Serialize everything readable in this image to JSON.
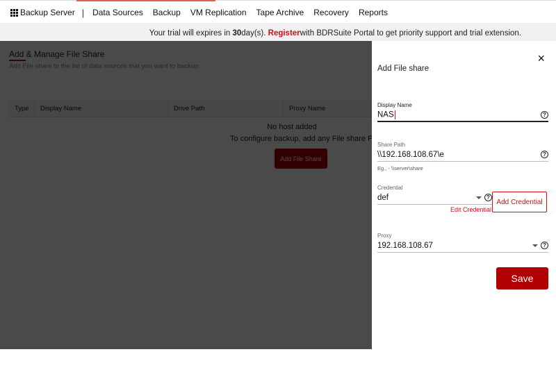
{
  "nav": {
    "brand": "Backup Server",
    "separator": "|",
    "items": [
      "Data Sources",
      "Backup",
      "VM Replication",
      "Tape Archive",
      "Recovery",
      "Reports"
    ]
  },
  "trial_banner": {
    "prefix": "Your trial will expires in ",
    "days": "30",
    "mid": " day(s). ",
    "register": "Register",
    "suffix": " with BDRSuite Portal to get priority support and trial extension."
  },
  "page": {
    "title": "Add & Manage File Share",
    "subtitle": "Add File share to the list of data sources that you want to backup.",
    "table_headers": [
      "Type",
      "Display Name",
      "Drive Path",
      "Proxy Name"
    ],
    "empty_title": "No host added",
    "empty_message": "To configure backup, add any File share Path",
    "add_button": "Add File Share"
  },
  "drawer": {
    "title": "Add File share",
    "close_icon": "×",
    "display_name": {
      "label": "Display Name",
      "value": "NAS"
    },
    "share_path": {
      "label": "Share Path",
      "value": "\\\\192.168.108.67\\e",
      "hint": "Eg., - \\\\server\\share"
    },
    "credential": {
      "label": "Credential",
      "value": "def",
      "edit_link": "Edit Credential",
      "add_button": "Add Credential"
    },
    "proxy": {
      "label": "Proxy",
      "value": "192.168.108.67"
    },
    "help_glyph": "?",
    "save_button": "Save"
  },
  "colors": {
    "accent": "#b10000",
    "link_red": "#d0101a"
  }
}
